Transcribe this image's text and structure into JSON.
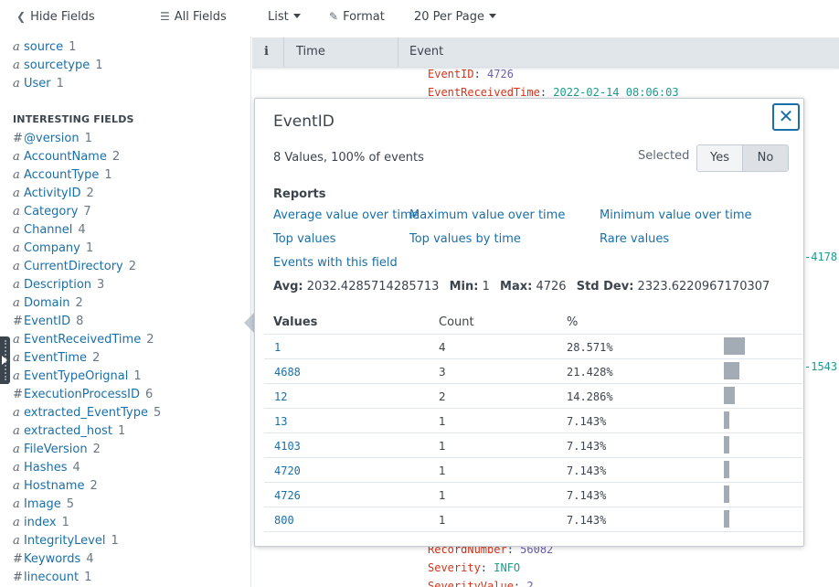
{
  "toolbar": {
    "hide_fields": "Hide Fields",
    "all_fields": "All Fields",
    "list": "List",
    "format": "Format",
    "per_page": "20 Per Page"
  },
  "sidebar": {
    "top_fields": [
      {
        "type": "a",
        "name": "source",
        "count": "1"
      },
      {
        "type": "a",
        "name": "sourcetype",
        "count": "1"
      },
      {
        "type": "a",
        "name": "User",
        "count": "1"
      }
    ],
    "interesting_heading": "INTERESTING FIELDS",
    "interesting_fields": [
      {
        "type": "#",
        "name": "@version",
        "count": "1"
      },
      {
        "type": "a",
        "name": "AccountName",
        "count": "2"
      },
      {
        "type": "a",
        "name": "AccountType",
        "count": "1"
      },
      {
        "type": "a",
        "name": "ActivityID",
        "count": "2"
      },
      {
        "type": "a",
        "name": "Category",
        "count": "7"
      },
      {
        "type": "a",
        "name": "Channel",
        "count": "4"
      },
      {
        "type": "a",
        "name": "Company",
        "count": "1"
      },
      {
        "type": "a",
        "name": "CurrentDirectory",
        "count": "2"
      },
      {
        "type": "a",
        "name": "Description",
        "count": "3"
      },
      {
        "type": "a",
        "name": "Domain",
        "count": "2"
      },
      {
        "type": "#",
        "name": "EventID",
        "count": "8"
      },
      {
        "type": "a",
        "name": "EventReceivedTime",
        "count": "2"
      },
      {
        "type": "a",
        "name": "EventTime",
        "count": "2"
      },
      {
        "type": "a",
        "name": "EventTypeOrignal",
        "count": "1"
      },
      {
        "type": "#",
        "name": "ExecutionProcessID",
        "count": "6"
      },
      {
        "type": "a",
        "name": "extracted_EventType",
        "count": "5"
      },
      {
        "type": "a",
        "name": "extracted_host",
        "count": "1"
      },
      {
        "type": "a",
        "name": "FileVersion",
        "count": "2"
      },
      {
        "type": "a",
        "name": "Hashes",
        "count": "4"
      },
      {
        "type": "a",
        "name": "Hostname",
        "count": "2"
      },
      {
        "type": "a",
        "name": "Image",
        "count": "5"
      },
      {
        "type": "a",
        "name": "index",
        "count": "1"
      },
      {
        "type": "a",
        "name": "IntegrityLevel",
        "count": "1"
      },
      {
        "type": "#",
        "name": "Keywords",
        "count": "4"
      },
      {
        "type": "#",
        "name": "linecount",
        "count": "1"
      }
    ]
  },
  "table": {
    "col_info": "i",
    "col_time": "Time",
    "col_event": "Event"
  },
  "events": {
    "top": [
      {
        "key": "EventID",
        "value": "4726",
        "kind": "num"
      },
      {
        "key": "EventReceivedTime",
        "value": "2022-02-14 08:06:03",
        "kind": "text"
      }
    ],
    "bottom": [
      {
        "key": "RecordNumber",
        "value": "56082",
        "kind": "num"
      },
      {
        "key": "Severity",
        "value": "INFO",
        "kind": "text"
      },
      {
        "key": "SeverityValue",
        "value": "2",
        "kind": "num"
      }
    ],
    "frag_1": "-4178",
    "frag_2": "-1543"
  },
  "popup": {
    "title": "EventID",
    "close_label": "✕",
    "summary": "8 Values, 100% of events",
    "selected_label": "Selected",
    "yes": "Yes",
    "no": "No",
    "reports_heading": "Reports",
    "reports": {
      "avg_over_time": "Average value over time",
      "max_over_time": "Maximum value over time",
      "min_over_time": "Minimum value over time",
      "top_values": "Top values",
      "top_values_by_time": "Top values by time",
      "rare_values": "Rare values",
      "events_with_field": "Events with this field"
    },
    "stats": {
      "avg_label": "Avg:",
      "avg": "2032.4285714285713",
      "min_label": "Min:",
      "min": "1",
      "max_label": "Max:",
      "max": "4726",
      "std_label": "Std Dev:",
      "std": "2323.6220967170307"
    },
    "values_header": "Values",
    "count_header": "Count",
    "pct_header": "%",
    "rows": [
      {
        "value": "1",
        "count": "4",
        "pct": "28.571%",
        "fraction": 0.28571
      },
      {
        "value": "4688",
        "count": "3",
        "pct": "21.428%",
        "fraction": 0.21428
      },
      {
        "value": "12",
        "count": "2",
        "pct": "14.286%",
        "fraction": 0.14286
      },
      {
        "value": "13",
        "count": "1",
        "pct": "7.143%",
        "fraction": 0.07143
      },
      {
        "value": "4103",
        "count": "1",
        "pct": "7.143%",
        "fraction": 0.07143
      },
      {
        "value": "4720",
        "count": "1",
        "pct": "7.143%",
        "fraction": 0.07143
      },
      {
        "value": "4726",
        "count": "1",
        "pct": "7.143%",
        "fraction": 0.07143
      },
      {
        "value": "800",
        "count": "1",
        "pct": "7.143%",
        "fraction": 0.07143
      }
    ]
  }
}
